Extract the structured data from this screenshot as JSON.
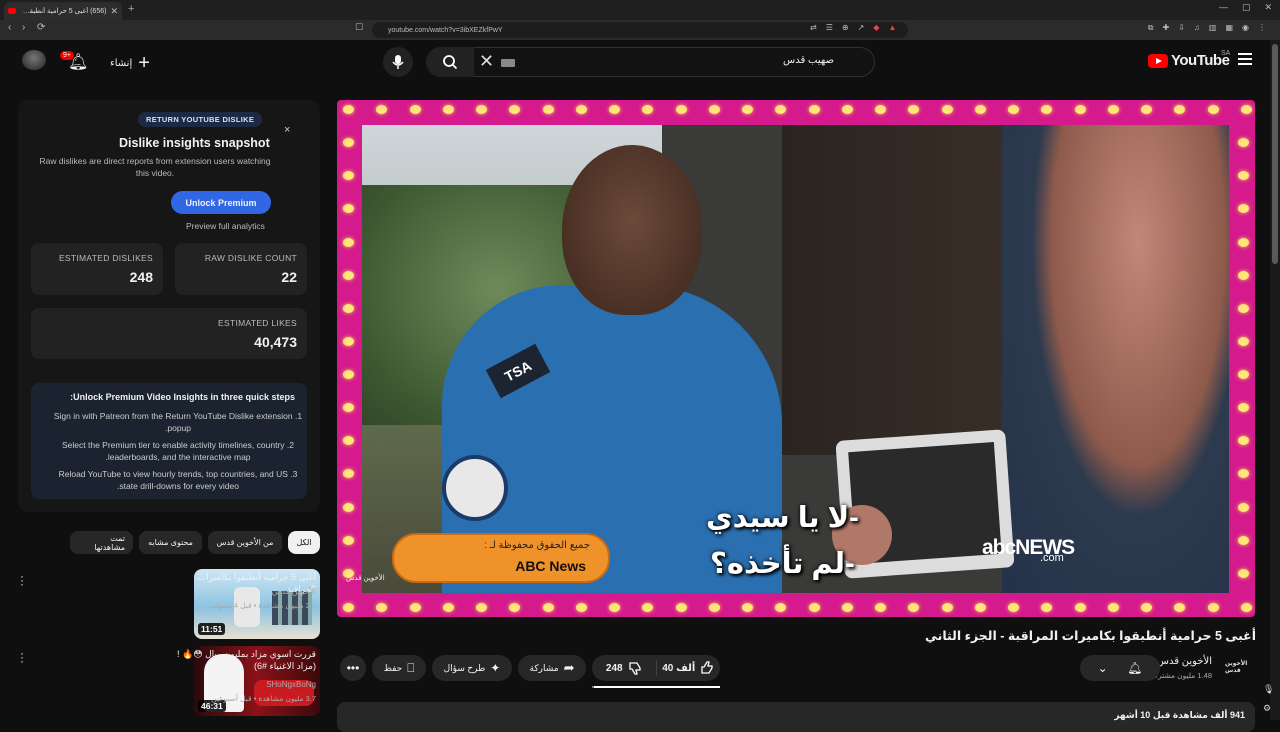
{
  "browser": {
    "tab_title": "(656) أغبى 5 حرامية أنطبقوا ...",
    "url": "youtube.com/watch?v=3ibXEZkfPwY",
    "new_tab": "+",
    "back": "‹",
    "forward": "›",
    "reload": "⟳",
    "win": [
      "—",
      "▢",
      "✕"
    ]
  },
  "header": {
    "logo_word": "YouTube",
    "country": "SA",
    "search_value": "صهيب قدس",
    "create_label": "إنشاء",
    "notif_badge": "9+"
  },
  "dislike_panel": {
    "pill": "RETURN YOUTUBE DISLIKE",
    "close": "×",
    "title": "Dislike insights snapshot",
    "desc": "Raw dislikes are direct reports from extension users watching this video.",
    "unlock": "Unlock Premium",
    "preview": "Preview full analytics",
    "stats": [
      {
        "label": "ESTIMATED DISLIKES",
        "value": "248"
      },
      {
        "label": "RAW DISLIKE COUNT",
        "value": "22"
      },
      {
        "label": "ESTIMATED LIKES",
        "value": "40,473"
      }
    ],
    "steps_title": "Unlock Premium Video Insights in three quick steps:",
    "steps": [
      "1. Sign in with Patreon from the Return YouTube Dislike extension popup.",
      "2. Select the Premium tier to enable activity timelines, country leaderboards, and the interactive map.",
      "3. Reload YouTube to view hourly trends, top countries, and US state drill-downs for every video."
    ]
  },
  "chips": [
    "الكل",
    "من الأخوين قدس",
    "محتوى مشابه",
    "تمت مشاهدتها"
  ],
  "recommendations": [
    {
      "title": "أغبى 5 حرامية أنطبقوا بكاميرات المراقبة",
      "channel": "الأخوين قدس",
      "meta": "2.7 مليون مشاهدة • قبل 4 سنوات",
      "duration": "11:51"
    },
    {
      "title": "قررت اسوي مزاد بمليون ريال 😳🔥 ! (مزاد الاغنياء #6)",
      "channel": "SHoNgxBoNg",
      "meta": "3.7 مليون مشاهدة • قبل أسبوعين",
      "duration": "46:31"
    }
  ],
  "video": {
    "subtitle_1": "-لا يا سيدي",
    "subtitle_2": "-لم تأخذه؟",
    "copyright_1": "جميع الحقوق محفوظة لـ :",
    "copyright_2": "ABC News",
    "network": "abcNEWS",
    "network_com": ".com",
    "badge": "TSA",
    "watermark": "الأخوين قدس"
  },
  "meta": {
    "title": "أغبى 5 حرامية أنطبقوا بكاميرات المراقبة - الجزء الثاني",
    "channel": "الأخوين قدس",
    "subs": "1.48 مليون مشترك",
    "likes": "40 ألف",
    "dislikes": "248",
    "share": "مشاركة",
    "ask": "طرح سؤال",
    "save": "حفظ",
    "description": "941 ألف مشاهدة  قبل 10 أشهر",
    "like_ratio": 0.995
  }
}
